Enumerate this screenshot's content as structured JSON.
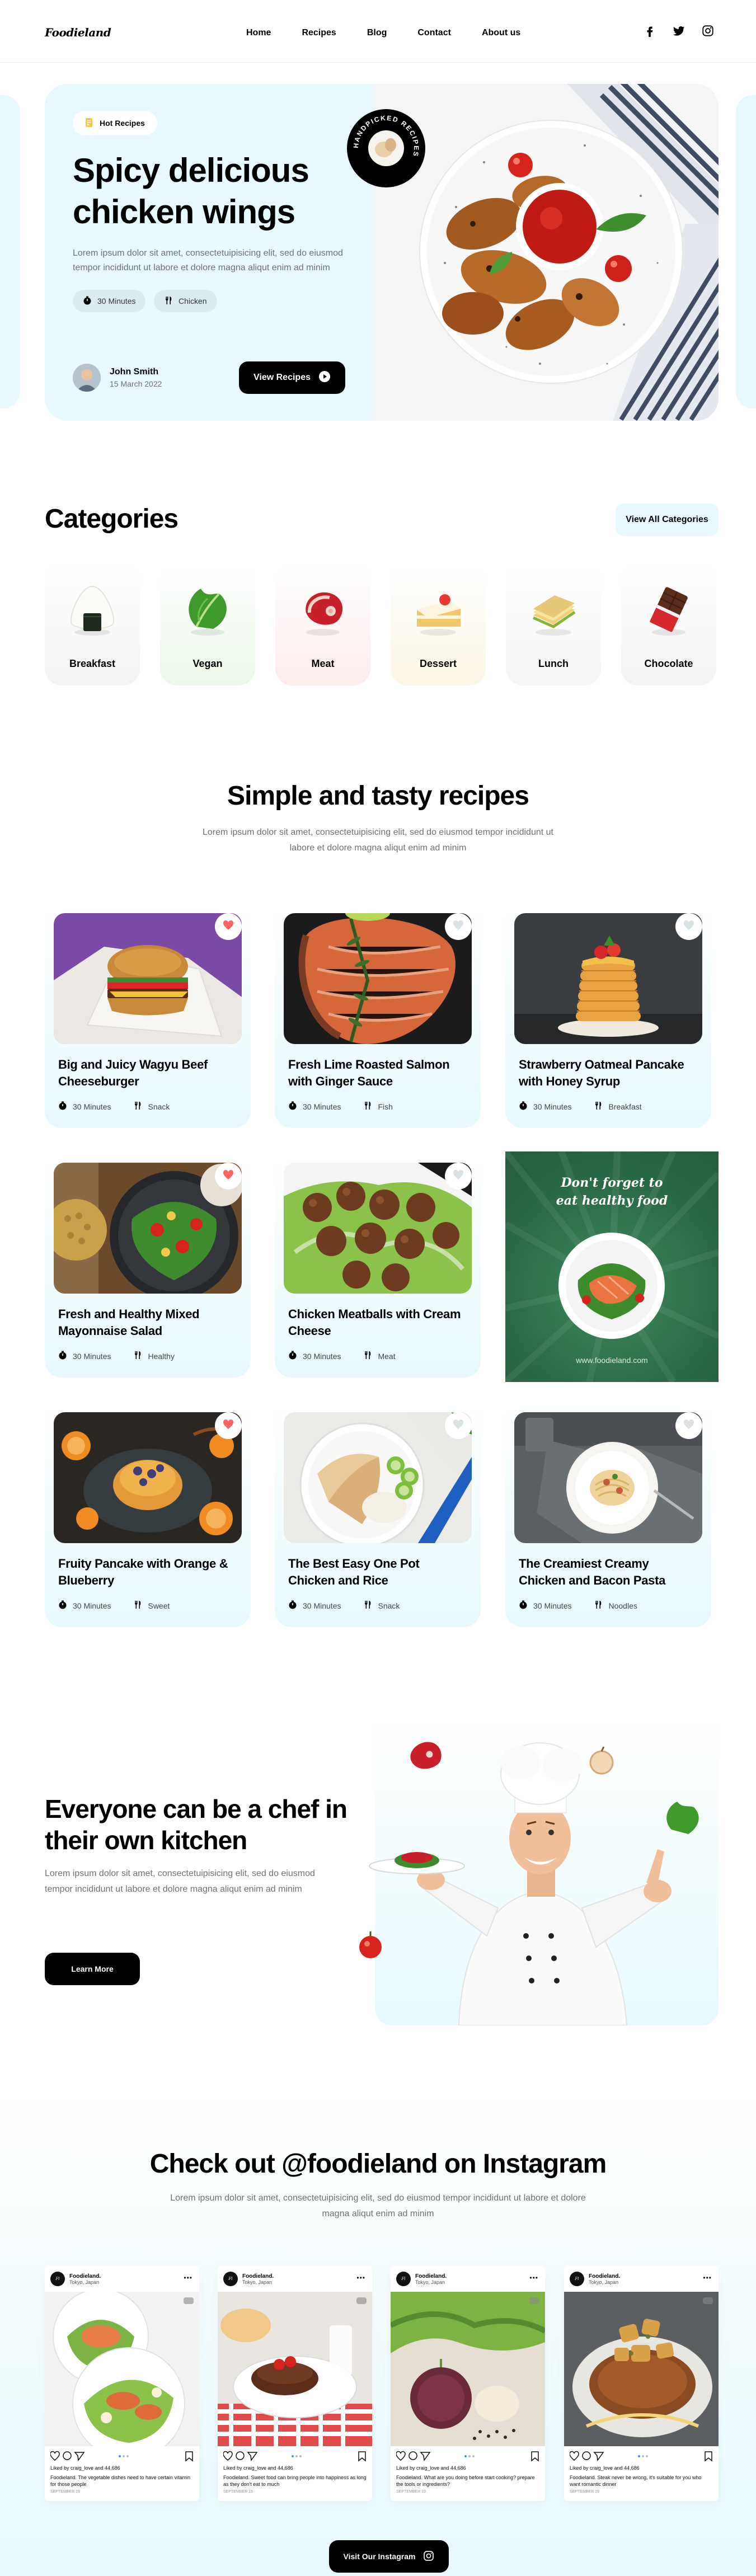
{
  "nav": {
    "logo": "Foodieland",
    "links": [
      "Home",
      "Recipes",
      "Blog",
      "Contact",
      "About us"
    ],
    "social_icons": [
      "facebook-icon",
      "twitter-icon",
      "instagram-icon"
    ]
  },
  "hero": {
    "badge": "Hot Recipes",
    "title": "Spicy delicious chicken wings",
    "description": "Lorem ipsum dolor sit amet, consectetuipisicing elit, sed do eiusmod tempor incididunt ut labore et dolore magna aliqut enim ad minim",
    "time": "30 Minutes",
    "category": "Chicken",
    "author_name": "John Smith",
    "author_date": "15 March 2022",
    "cta": "View Recipes",
    "stamp_text": "HANDPICKED RECIPES"
  },
  "categories": {
    "title": "Categories",
    "view_all": "View All Categories",
    "items": [
      {
        "label": "Breakfast",
        "icon": "onigiri-icon",
        "color": "#f3f3f3"
      },
      {
        "label": "Vegan",
        "icon": "lettuce-icon",
        "color": "#ebf8e9"
      },
      {
        "label": "Meat",
        "icon": "steak-icon",
        "color": "#fdecec"
      },
      {
        "label": "Dessert",
        "icon": "cake-icon",
        "color": "#fcf6e6"
      },
      {
        "label": "Lunch",
        "icon": "sandwich-icon",
        "color": "#f5f5f5"
      },
      {
        "label": "Chocolate",
        "icon": "chocolate-icon",
        "color": "#f3f3f3"
      }
    ]
  },
  "recipes": {
    "title": "Simple and tasty recipes",
    "description": "Lorem ipsum dolor sit amet, consectetuipisicing elit, sed do eiusmod tempor incididunt ut labore et dolore magna aliqut enim ad minim",
    "items": [
      {
        "title": "Big and Juicy Wagyu Beef Cheeseburger",
        "time": "30 Minutes",
        "tag": "Snack",
        "liked": true
      },
      {
        "title": "Fresh Lime Roasted Salmon with Ginger Sauce",
        "time": "30 Minutes",
        "tag": "Fish",
        "liked": false
      },
      {
        "title": "Strawberry Oatmeal Pancake with Honey Syrup",
        "time": "30 Minutes",
        "tag": "Breakfast",
        "liked": false
      },
      {
        "title": "Fresh and Healthy Mixed Mayonnaise Salad",
        "time": "30 Minutes",
        "tag": "Healthy",
        "liked": true
      },
      {
        "title": "Chicken Meatballs with Cream Cheese",
        "time": "30 Minutes",
        "tag": "Meat",
        "liked": false
      },
      {
        "title": "Fruity Pancake with Orange & Blueberry",
        "time": "30 Minutes",
        "tag": "Sweet",
        "liked": true
      },
      {
        "title": "The Best Easy One Pot Chicken and Rice",
        "time": "30 Minutes",
        "tag": "Snack",
        "liked": false
      },
      {
        "title": "The Creamiest Creamy Chicken and Bacon Pasta",
        "time": "30 Minutes",
        "tag": "Noodles",
        "liked": false
      }
    ],
    "promo": {
      "title": "Don't forget to eat healthy food",
      "url": "www.foodieland.com"
    }
  },
  "chef": {
    "title": "Everyone can be a chef in their own kitchen",
    "description": "Lorem ipsum dolor sit amet, consectetuipisicing elit, sed do eiusmod tempor incididunt ut labore et dolore magna aliqut enim ad minim",
    "cta": "Learn More"
  },
  "instagram": {
    "title": "Check out @foodieland on Instagram",
    "description": "Lorem ipsum dolor sit amet, consectetuipisicing elit, sed do eiusmod tempor incididunt ut labore et dolore magna aliqut enim ad minim",
    "cta": "Visit Our Instagram",
    "posts": [
      {
        "user": "Foodieland.",
        "location": "Tokyo, Japan",
        "likes": "Liked by craig_love and 44,686",
        "caption": "Foodieland. The vegetable dishes need to have certain vitamin for those people",
        "date": "September 19"
      },
      {
        "user": "Foodieland.",
        "location": "Tokyo, Japan",
        "likes": "Liked by craig_love and 44,686",
        "caption": "Foodieland. Sweet food can bring people into happiness as long as they don't eat to much",
        "date": "September 19"
      },
      {
        "user": "Foodieland.",
        "location": "Tokyo, Japan",
        "likes": "Liked by craig_love and 44,686",
        "caption": "Foodieland. What are you doing before start cooking? prepare the tools or ingredients?",
        "date": "September 19"
      },
      {
        "user": "Foodieland.",
        "location": "Tokyo, Japan",
        "likes": "Liked by craig_love and 44,686",
        "caption": "Foodieland. Steak never be wrong, it's suitable for you who want romantic dinner",
        "date": "September 19"
      }
    ]
  }
}
